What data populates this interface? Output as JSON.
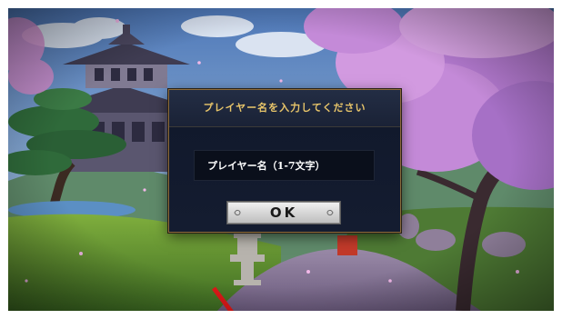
{
  "dialog": {
    "title": "プレイヤー名を入力してください",
    "name_input": {
      "value": "",
      "placeholder": "プレイヤー名（1-7文字）"
    },
    "ok_label": "OK"
  },
  "colors": {
    "title_gold": "#e9c66a",
    "dialog_bg": "#10182b",
    "border_gold": "#8b6a3a",
    "button_silver": "#d9d9d9",
    "sakura_pink": "#c98ad6",
    "sky_blue": "#6b8fbf"
  },
  "icons": {
    "ok_left_ornament": "ornament-left-icon",
    "ok_right_ornament": "ornament-right-icon"
  }
}
